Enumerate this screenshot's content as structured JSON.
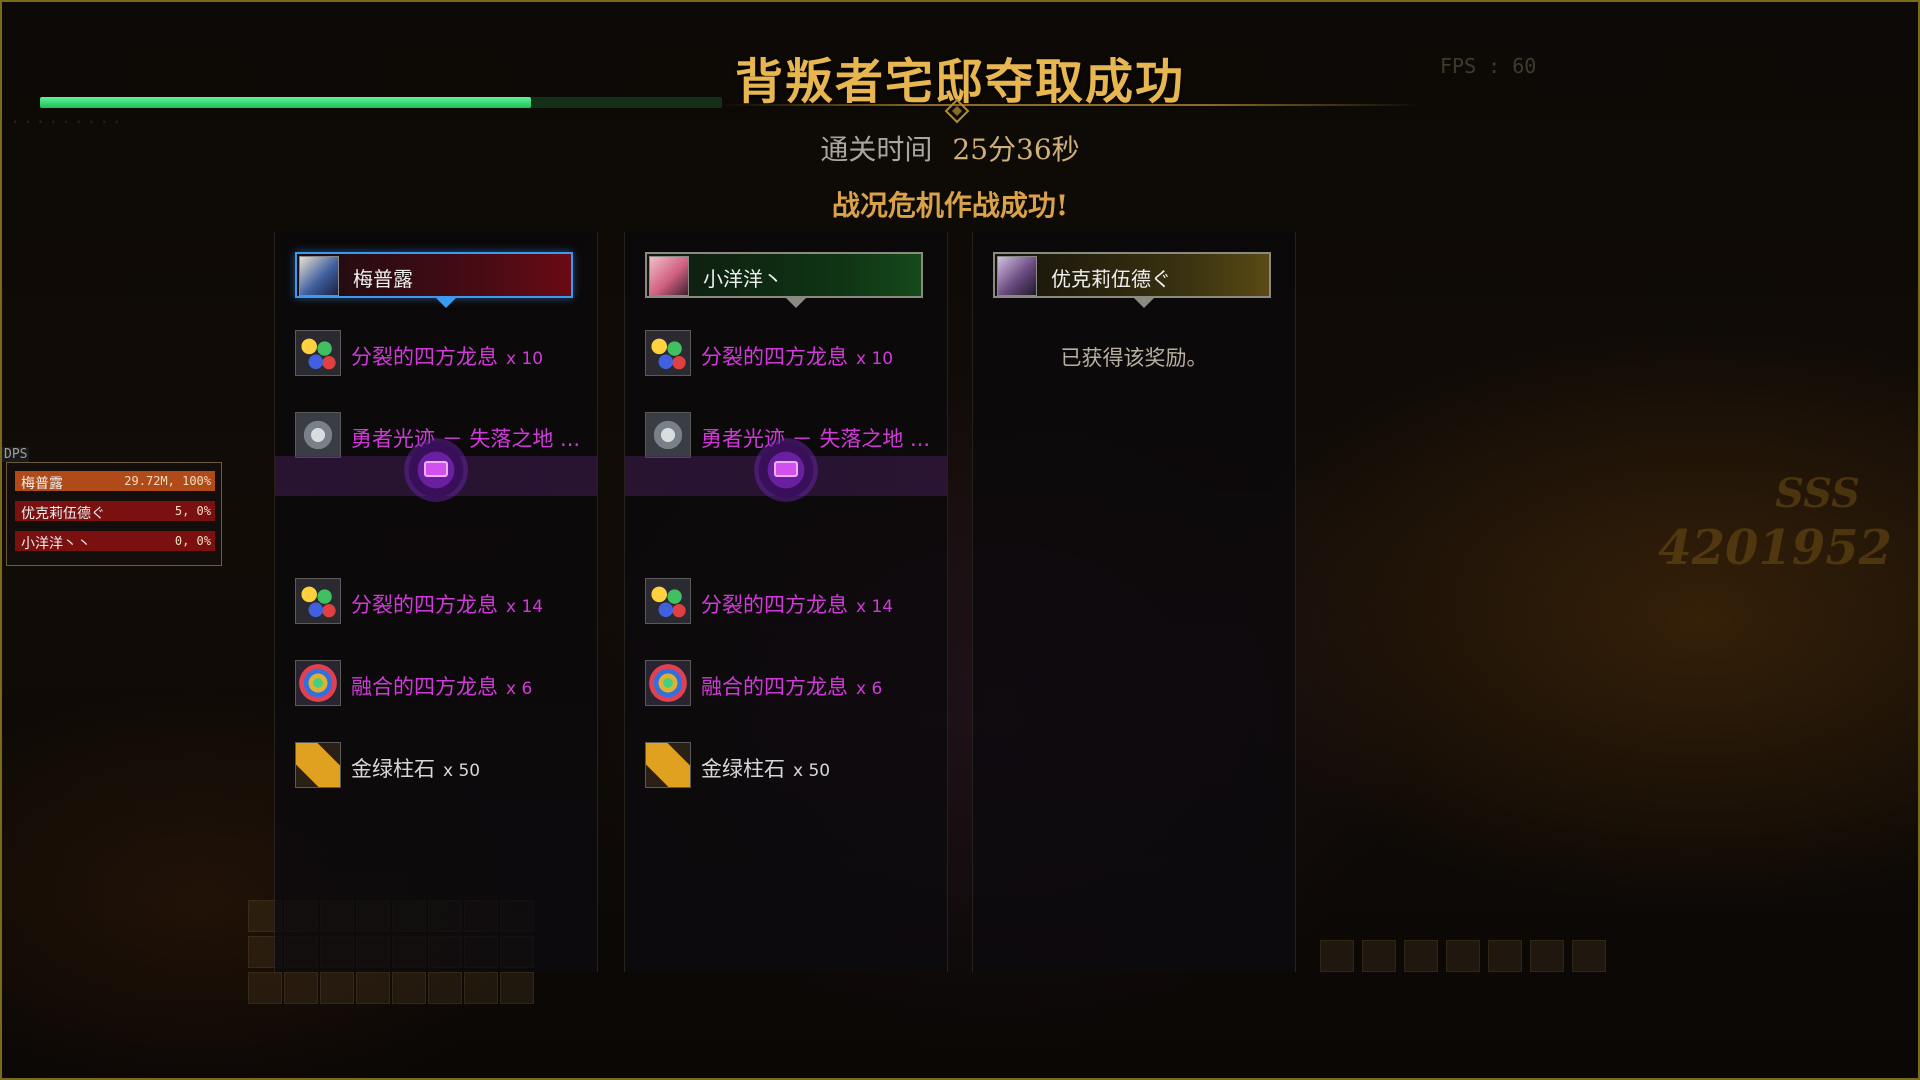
{
  "header": {
    "title": "背叛者宅邸夺取成功",
    "clear_time_label": "通关时间",
    "clear_time_value": "25分36秒",
    "success_text": "战况危机作战成功!"
  },
  "progress": {
    "fraction": 0.72,
    "color": "#2fdc6e"
  },
  "players": [
    {
      "name": "梅普露",
      "frame_color": "#3a9af0",
      "rewards": [
        {
          "icon": "split-dragon-breath-icon",
          "name": "分裂的四方龙息",
          "qty": "x 10",
          "color": "purple"
        },
        {
          "icon": "brave-trace-icon",
          "name": "勇者光迹 － 失落之地 ...",
          "qty": "",
          "color": "purple"
        }
      ],
      "bonus_rewards": [
        {
          "icon": "split-dragon-breath-icon",
          "name": "分裂的四方龙息",
          "qty": "x 14",
          "color": "purple"
        },
        {
          "icon": "fusion-dragon-breath-icon",
          "name": "融合的四方龙息",
          "qty": "x 6",
          "color": "purple"
        },
        {
          "icon": "gold-green-stone-icon",
          "name": "金绿柱石",
          "qty": "x 50",
          "color": "white"
        }
      ]
    },
    {
      "name": "小洋洋丶",
      "frame_color": "#8a8a80",
      "rewards": [
        {
          "icon": "split-dragon-breath-icon",
          "name": "分裂的四方龙息",
          "qty": "x 10",
          "color": "purple"
        },
        {
          "icon": "brave-trace-icon",
          "name": "勇者光迹 － 失落之地 ...",
          "qty": "",
          "color": "purple"
        }
      ],
      "bonus_rewards": [
        {
          "icon": "split-dragon-breath-icon",
          "name": "分裂的四方龙息",
          "qty": "x 14",
          "color": "purple"
        },
        {
          "icon": "fusion-dragon-breath-icon",
          "name": "融合的四方龙息",
          "qty": "x 6",
          "color": "purple"
        },
        {
          "icon": "gold-green-stone-icon",
          "name": "金绿柱石",
          "qty": "x 50",
          "color": "white"
        }
      ]
    },
    {
      "name": "优克莉伍德ぐ",
      "frame_color": "#8a8a80",
      "received_text": "已获得该奖励。"
    }
  ],
  "dps_meter": {
    "label": "DPS",
    "rows": [
      {
        "name": "梅普露",
        "value": "29.72M, 100%",
        "fraction": 1.0,
        "color": "#b04a18"
      },
      {
        "name": "优克莉伍德ぐ",
        "value": "5, 0%",
        "fraction": 1.0,
        "color": "#7a1010"
      },
      {
        "name": "小洋洋丶丶",
        "value": "0, 0%",
        "fraction": 1.0,
        "color": "#7a1010"
      }
    ]
  },
  "background": {
    "fps": "FPS : 60",
    "rank": "SSS",
    "score": "4201952"
  }
}
